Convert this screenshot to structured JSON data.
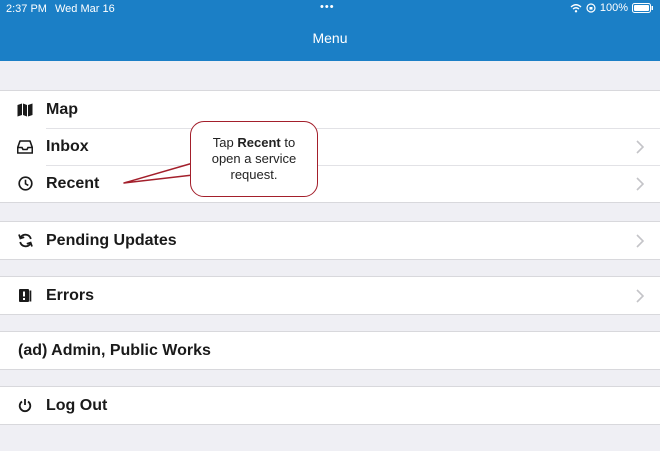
{
  "status_bar": {
    "time": "2:37 PM",
    "date": "Wed Mar 16",
    "dots": "•••",
    "battery": "100%",
    "icons": [
      "wifi-icon",
      "orientation-lock-icon",
      "battery-icon"
    ]
  },
  "header": {
    "title": "Menu"
  },
  "menu": {
    "group1": [
      {
        "label": "Map",
        "icon": "map-icon",
        "chevron": false
      },
      {
        "label": "Inbox",
        "icon": "inbox-icon",
        "chevron": true
      },
      {
        "label": "Recent",
        "icon": "clock-icon",
        "chevron": true
      }
    ],
    "group2": [
      {
        "label": "Pending Updates",
        "icon": "sync-icon",
        "chevron": true
      }
    ],
    "group3": [
      {
        "label": "Errors",
        "icon": "errors-icon",
        "chevron": true
      }
    ],
    "group4": [
      {
        "label": "(ad) Admin, Public Works",
        "chevron": false
      }
    ],
    "group5": [
      {
        "label": "Log Out",
        "icon": "power-icon",
        "chevron": false
      }
    ]
  },
  "callout": {
    "prefix": "Tap ",
    "bold": "Recent",
    "suffix": " to open a service request."
  },
  "colors": {
    "header_bg": "#1b7fc6",
    "background": "#efeff4",
    "callout_border": "#a31f2b"
  }
}
